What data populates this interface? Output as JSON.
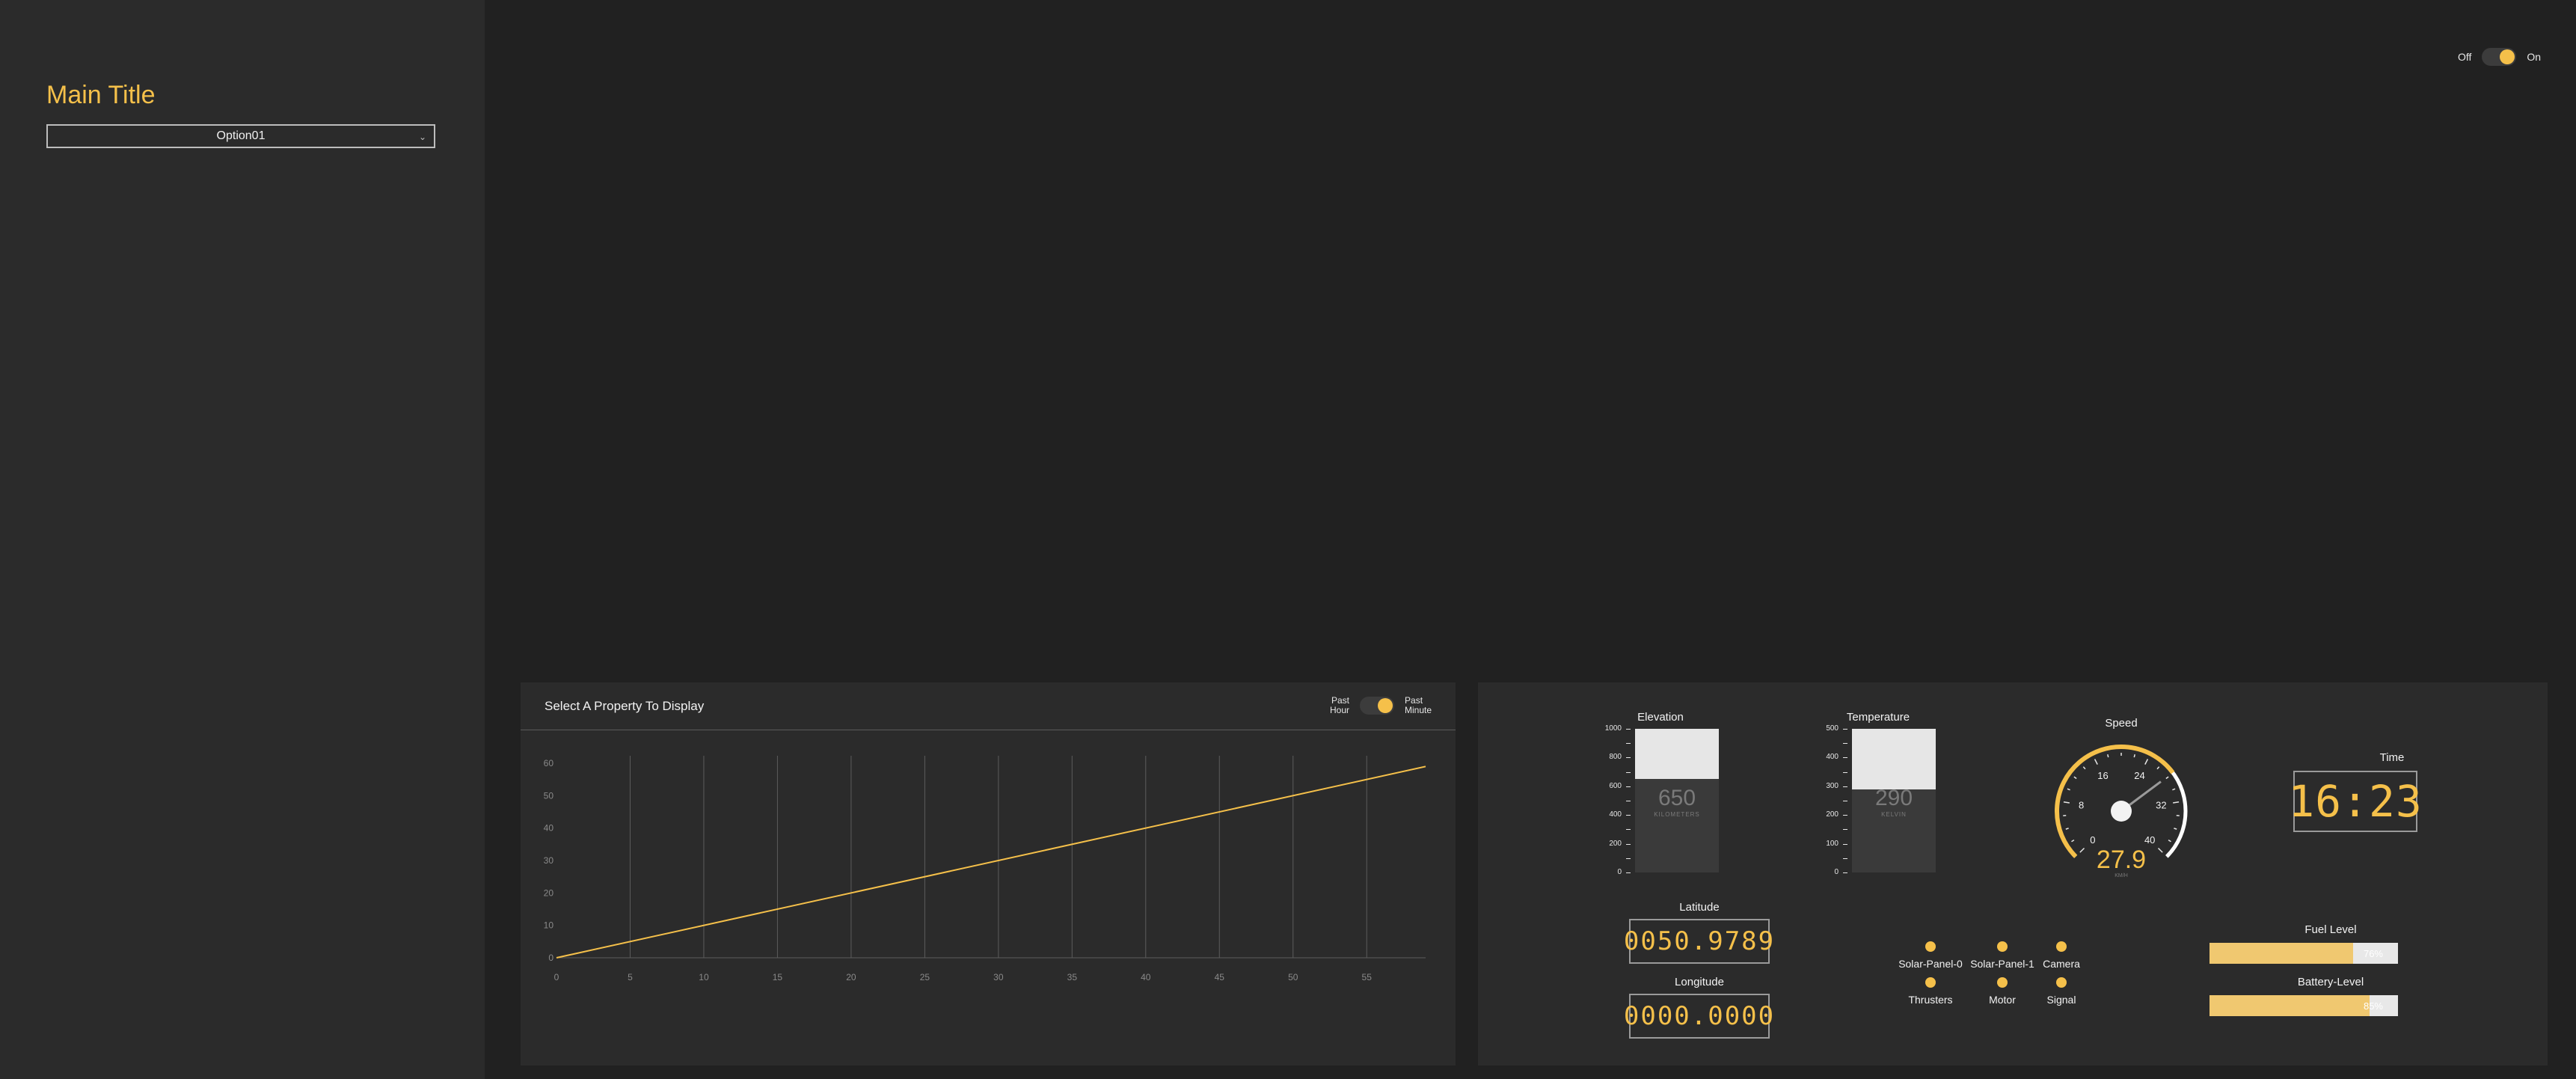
{
  "sidebar": {
    "title": "Main Title",
    "dropdown": {
      "selected": "Option01"
    }
  },
  "top_toggle": {
    "off_label": "Off",
    "on_label": "On",
    "state": "on"
  },
  "chart_panel": {
    "title": "Select A Property To Display",
    "toggle": {
      "left_label_line1": "Past",
      "left_label_line2": "Hour",
      "right_label_line1": "Past",
      "right_label_line2": "Minute",
      "state": "right"
    }
  },
  "chart_data": {
    "type": "line",
    "xlim": [
      0,
      59
    ],
    "ylim": [
      0,
      60
    ],
    "x_ticks": [
      0,
      5,
      10,
      15,
      20,
      25,
      30,
      35,
      40,
      45,
      50,
      55
    ],
    "y_ticks": [
      0,
      10,
      20,
      30,
      40,
      50,
      60
    ],
    "grid": "vertical",
    "line_color": "#f5c04a",
    "series": [
      {
        "x": [
          0,
          59
        ],
        "y": [
          0,
          59
        ]
      }
    ]
  },
  "gauges": {
    "elevation": {
      "label": "Elevation",
      "value": "650",
      "unit": "KILOMETERS",
      "scale": [
        "1000",
        "800",
        "600",
        "400",
        "200",
        "0"
      ],
      "fraction": 0.65
    },
    "temperature": {
      "label": "Temperature",
      "value": "290",
      "unit": "KELVIN",
      "scale": [
        "500",
        "400",
        "300",
        "200",
        "100",
        "0"
      ],
      "fraction": 0.58
    },
    "speed": {
      "label": "Speed",
      "value": "27.9",
      "unit": "KM/H",
      "ticks": [
        "0",
        "8",
        "16",
        "24",
        "32",
        "40"
      ],
      "min": 0,
      "max": 40
    },
    "time": {
      "label": "Time",
      "value": "16:23"
    },
    "latitude": {
      "label": "Latitude",
      "value": "0050.9789"
    },
    "longitude": {
      "label": "Longitude",
      "value": "0000.0000"
    }
  },
  "status_indicators": [
    {
      "label": "Solar-Panel-0"
    },
    {
      "label": "Solar-Panel-1"
    },
    {
      "label": "Camera"
    },
    {
      "label": "Thrusters"
    },
    {
      "label": "Motor"
    },
    {
      "label": "Signal"
    }
  ],
  "levels": {
    "fuel": {
      "label": "Fuel Level",
      "value_text": "76%",
      "fraction": 0.76
    },
    "battery": {
      "label": "Battery-Level",
      "value_text": "85%",
      "fraction": 0.85
    }
  },
  "colors": {
    "accent": "#f5c04a",
    "background": "#212121",
    "panel": "#2b2b2b"
  }
}
